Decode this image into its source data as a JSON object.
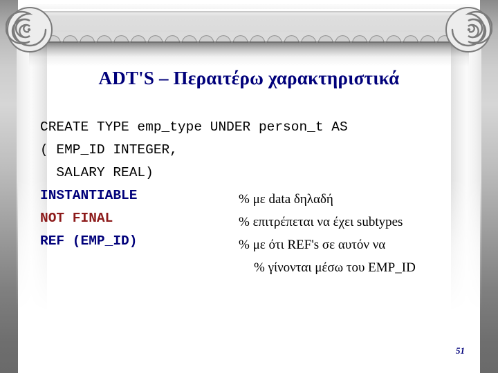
{
  "slide": {
    "title": "ADT'S – Περαιτέρω χαρακτηριστικά",
    "page_number": "51",
    "theme": {
      "title_color": "#00007a",
      "keyword_navy": "#00007a",
      "keyword_red": "#8c1a1a",
      "body_color": "#000000",
      "background": "#ffffff",
      "ornament_gray": "#7b7b7b"
    }
  },
  "code": {
    "lines": [
      {
        "text": "CREATE TYPE emp_type UNDER person_t AS",
        "style": "black"
      },
      {
        "text": "( EMP_ID INTEGER,",
        "style": "black"
      },
      {
        "text": "  SALARY REAL)",
        "style": "black"
      },
      {
        "text": "INSTANTIABLE",
        "style": "navy"
      },
      {
        "text": "NOT FINAL",
        "style": "red"
      },
      {
        "text": "REF (EMP_ID)",
        "style": "navy"
      }
    ]
  },
  "comments": {
    "lines": [
      {
        "text": "% με data δηλαδή",
        "indent": false
      },
      {
        "text": "% επιτρέπεται να έχει subtypes",
        "indent": false
      },
      {
        "text": "% με ότι REF's σε αυτόν να",
        "indent": false
      },
      {
        "text": "% γίνονται μέσω του EMP_ID",
        "indent": true
      }
    ]
  },
  "ornaments": {
    "left_volute": "ionic-volute-spiral",
    "right_volute": "ionic-volute-spiral",
    "dentil_count": 26
  }
}
